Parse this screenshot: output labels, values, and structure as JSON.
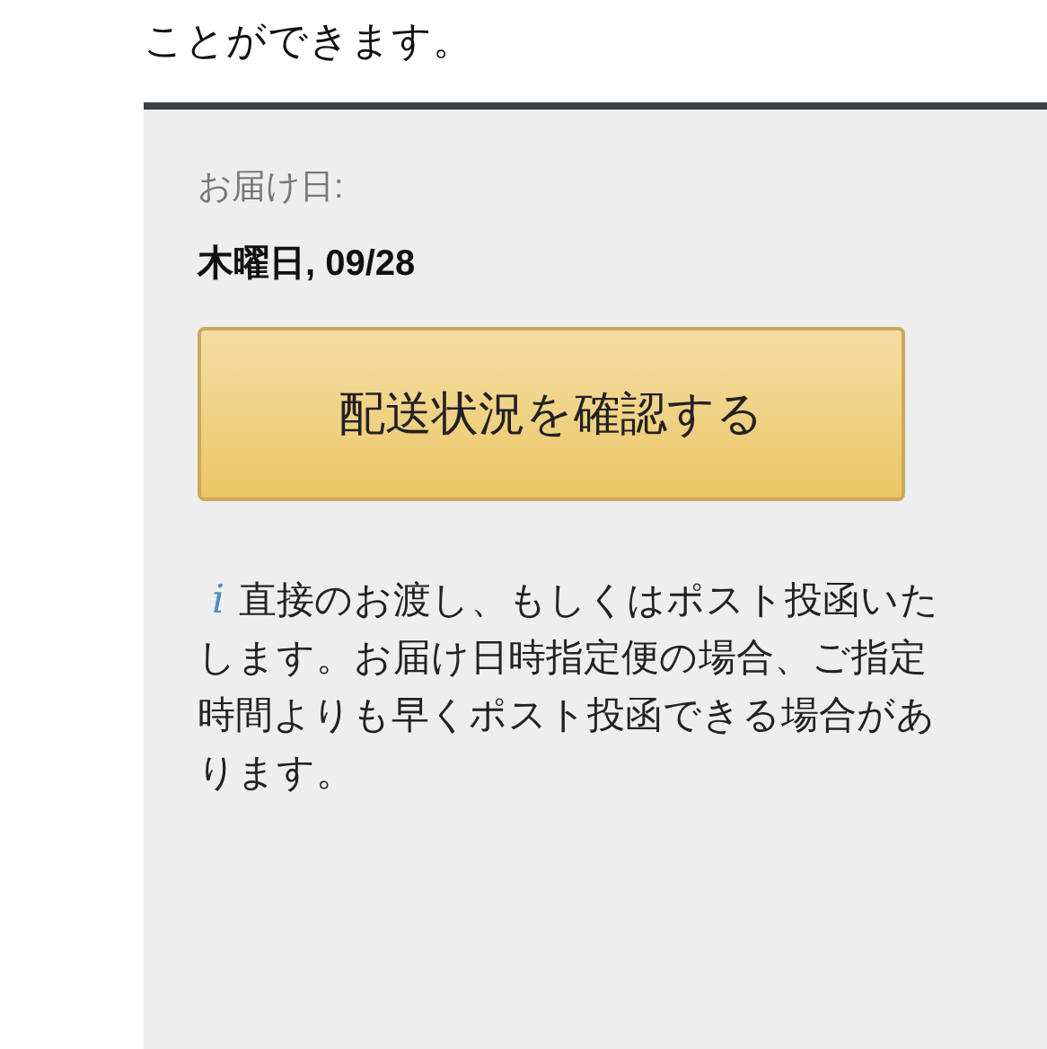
{
  "intro_text": "ことができます。",
  "delivery": {
    "label": "お届け日:",
    "date": "木曜日, 09/28"
  },
  "track_button": "配送状況を確認する",
  "note": {
    "icon": "i",
    "lines": [
      "直接のお渡し、もしくはポスト投函いた",
      "します。お届け日時指定便の場合、ご指定",
      "時間よりも早くポスト投函できる場合があ",
      "ります。"
    ]
  }
}
